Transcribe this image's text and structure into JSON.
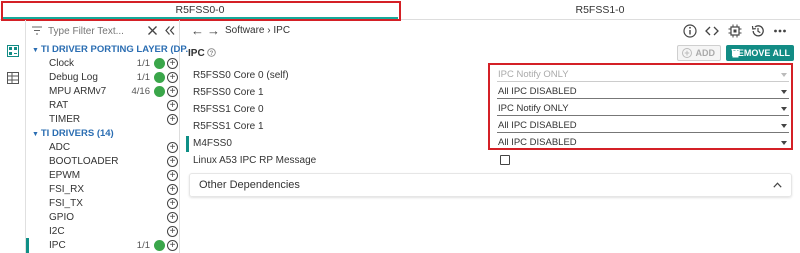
{
  "tabs": [
    {
      "label": "R5FSS0-0",
      "active": true
    },
    {
      "label": "R5FSS1-0",
      "active": false
    }
  ],
  "colors": {
    "accent": "#17a99a",
    "highlight_box": "#d42026",
    "primary_button": "#128c85",
    "category_text": "#2a6db2",
    "check_green": "#3aa64a"
  },
  "sidebar": {
    "filter_placeholder": "Type Filter Text...",
    "categories": [
      {
        "label": "TI DRIVER PORTING LAYER (DP...",
        "items": [
          {
            "label": "Clock",
            "count": "1/1",
            "status": "ok"
          },
          {
            "label": "Debug Log",
            "count": "1/1",
            "status": "ok"
          },
          {
            "label": "MPU ARMv7",
            "count": "4/16",
            "status": "ok"
          },
          {
            "label": "RAT",
            "count": "",
            "status": ""
          },
          {
            "label": "TIMER",
            "count": "",
            "status": ""
          }
        ]
      },
      {
        "label": "TI DRIVERS (14)",
        "items": [
          {
            "label": "ADC",
            "count": "",
            "status": ""
          },
          {
            "label": "BOOTLOADER",
            "count": "",
            "status": ""
          },
          {
            "label": "EPWM",
            "count": "",
            "status": ""
          },
          {
            "label": "FSI_RX",
            "count": "",
            "status": ""
          },
          {
            "label": "FSI_TX",
            "count": "",
            "status": ""
          },
          {
            "label": "GPIO",
            "count": "",
            "status": ""
          },
          {
            "label": "I2C",
            "count": "",
            "status": ""
          },
          {
            "label": "IPC",
            "count": "1/1",
            "status": "ok",
            "selected": true
          }
        ]
      }
    ]
  },
  "breadcrumb": {
    "root": "Software",
    "separator": "›",
    "current": "IPC"
  },
  "toolbar_icons": [
    "info-icon",
    "code-icon",
    "chip-icon",
    "history-icon",
    "more-icon"
  ],
  "main": {
    "title": "IPC",
    "add_label": "ADD",
    "remove_all_label": "REMOVE ALL",
    "settings": [
      {
        "label": "R5FSS0 Core 0 (self)",
        "value": "IPC Notify ONLY",
        "disabled": true
      },
      {
        "label": "R5FSS0 Core 1",
        "value": "All IPC DISABLED",
        "disabled": false
      },
      {
        "label": "R5FSS1 Core 0",
        "value": "IPC Notify ONLY",
        "disabled": false
      },
      {
        "label": "R5FSS1 Core 1",
        "value": "All IPC DISABLED",
        "disabled": false
      },
      {
        "label": "M4FSS0",
        "value": "All IPC DISABLED",
        "disabled": false
      }
    ],
    "checkbox_setting": {
      "label": "Linux A53 IPC RP Message",
      "checked": false
    },
    "other_dependencies": "Other Dependencies"
  }
}
